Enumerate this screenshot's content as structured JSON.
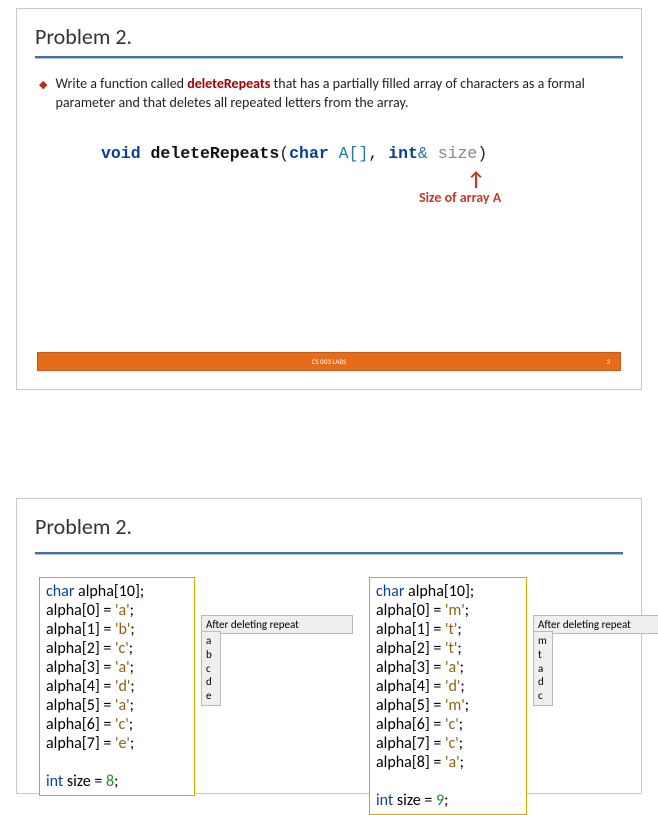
{
  "slide1": {
    "title": "Problem 2.",
    "bullet_pre": "Write a function called ",
    "bullet_fn": "deleteRepeats",
    "bullet_post": " that has a partially filled array of characters as a formal parameter and that deletes all repeated letters from the array.",
    "sig": {
      "kw_void": "void",
      "fn": "deleteRepeats",
      "op_open": "(",
      "ty_char": "char",
      "id_A": " A[]",
      "comma": ", ",
      "ty_int": "int",
      "amp": "&",
      "sz": " size",
      "op_close": ")"
    },
    "arrow": "↑",
    "arrow_label": "Size of array A",
    "footer_center": "CS 003 LABS",
    "footer_num": "3"
  },
  "slide2": {
    "title": "Problem 2.",
    "example_left": {
      "decl": "char alpha[10];",
      "lines": [
        "alpha[0] = 'a';",
        "alpha[1] = 'b';",
        "alpha[2] = 'c';",
        "alpha[3] = 'a';",
        "alpha[4] = 'd';",
        "alpha[5] = 'a';",
        "alpha[6] = 'c';",
        "alpha[7] = 'e';"
      ],
      "size_line": "int size = 8;",
      "result_title": "After deleting repeat",
      "result": "a\nb\nc\nd\ne"
    },
    "example_right": {
      "decl": "char alpha[10];",
      "lines": [
        "alpha[0] = 'm';",
        "alpha[1] = 't';",
        "alpha[2] = 't';",
        "alpha[3] = 'a';",
        "alpha[4] = 'd';",
        "alpha[5] = 'm';",
        "alpha[6] = 'c';",
        "alpha[7] = 'c';",
        "alpha[8] = 'a';"
      ],
      "size_line": "int size = 9;",
      "result_title": "After deleting repeat",
      "result": "m\nt\na\nd\nc"
    }
  }
}
